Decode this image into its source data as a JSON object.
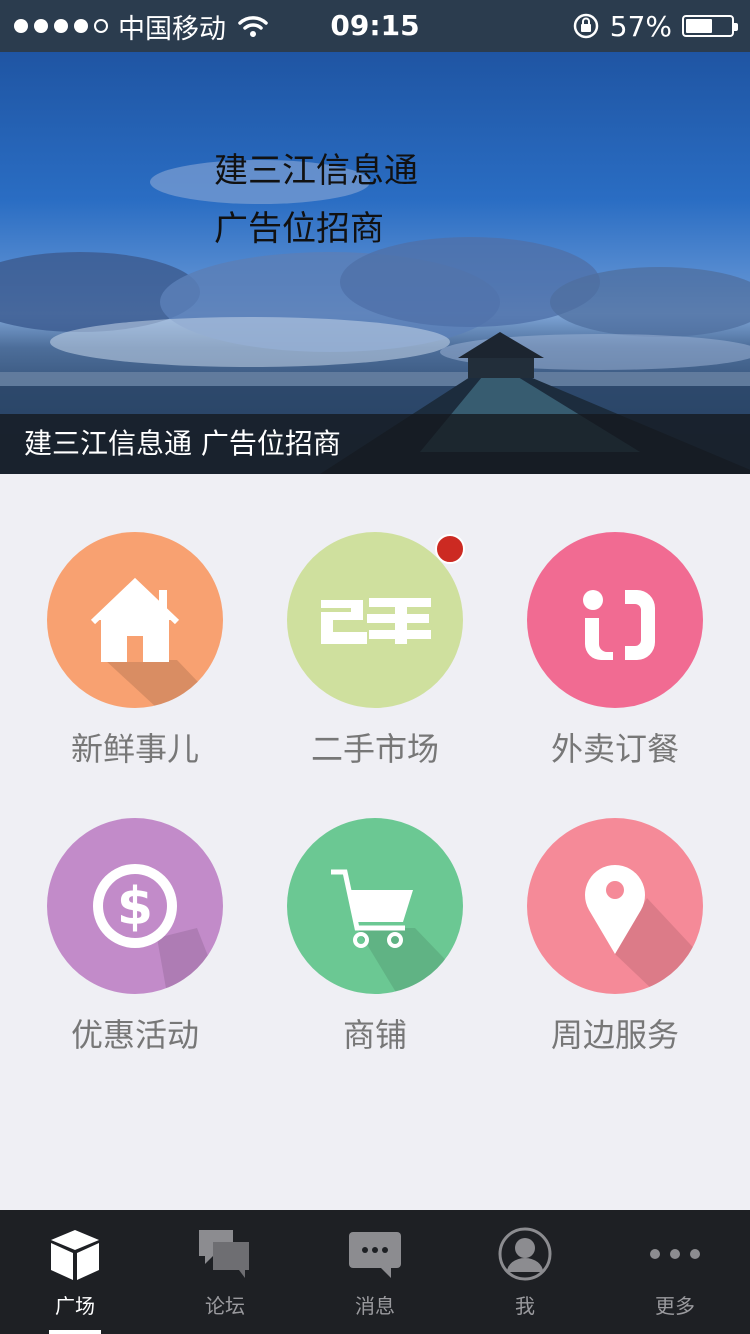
{
  "status_bar": {
    "carrier": "中国移动",
    "time": "09:15",
    "battery": "57%",
    "signal_bars": 4
  },
  "banner": {
    "overlay_line1": "建三江信息通",
    "overlay_line2": "广告位招商",
    "caption": "建三江信息通 广告位招商"
  },
  "grid": [
    {
      "label": "新鲜事儿",
      "icon": "house-icon",
      "color": "#f8a171",
      "badge": false
    },
    {
      "label": "二手市场",
      "icon": "second-hand-icon",
      "color": "#cfe09e",
      "badge": true
    },
    {
      "label": "外卖订餐",
      "icon": "phone-order-icon",
      "color": "#f16b92",
      "badge": false
    },
    {
      "label": "优惠活动",
      "icon": "dollar-coin-icon",
      "color": "#c28bc9",
      "badge": false
    },
    {
      "label": "商铺",
      "icon": "shopping-cart-icon",
      "color": "#6bc893",
      "badge": false
    },
    {
      "label": "周边服务",
      "icon": "location-pin-icon",
      "color": "#f58a98",
      "badge": false
    }
  ],
  "tabbar": {
    "items": [
      {
        "label": "广场",
        "icon": "cube-icon",
        "active": true
      },
      {
        "label": "论坛",
        "icon": "forum-bubbles-icon",
        "active": false
      },
      {
        "label": "消息",
        "icon": "message-bubble-icon",
        "active": false
      },
      {
        "label": "我",
        "icon": "user-avatar-icon",
        "active": false
      },
      {
        "label": "更多",
        "icon": "more-dots-icon",
        "active": false
      }
    ]
  }
}
